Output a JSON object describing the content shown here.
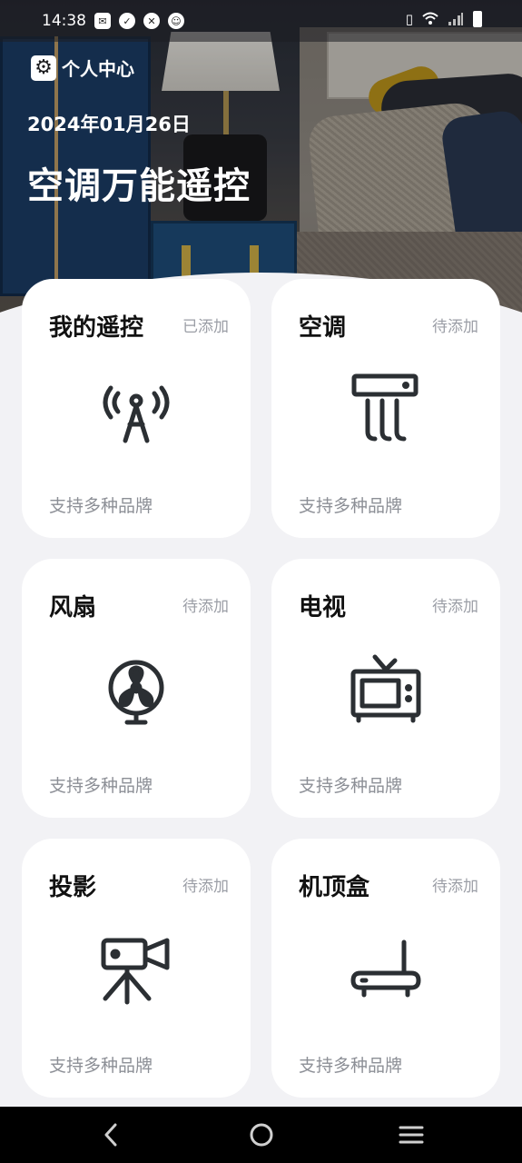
{
  "status_bar": {
    "time": "14:38",
    "left_icons": [
      "mail-icon",
      "check-circle-icon",
      "shield-icon",
      "alien-icon"
    ],
    "right_icons": [
      "vibrate-icon",
      "wifi-icon",
      "signal-icon",
      "battery-icon"
    ]
  },
  "header": {
    "personal_center": "个人中心",
    "date": "2024年01月26日",
    "app_title": "空调万能遥控"
  },
  "cards": [
    {
      "title": "我的遥控",
      "status": "已添加",
      "subtitle": "支持多种品牌",
      "icon": "antenna-tower-icon"
    },
    {
      "title": "空调",
      "status": "待添加",
      "subtitle": "支持多种品牌",
      "icon": "air-conditioner-icon"
    },
    {
      "title": "风扇",
      "status": "待添加",
      "subtitle": "支持多种品牌",
      "icon": "fan-icon"
    },
    {
      "title": "电视",
      "status": "待添加",
      "subtitle": "支持多种品牌",
      "icon": "tv-icon"
    },
    {
      "title": "投影",
      "status": "待添加",
      "subtitle": "支持多种品牌",
      "icon": "projector-camera-icon"
    },
    {
      "title": "机顶盒",
      "status": "待添加",
      "subtitle": "支持多种品牌",
      "icon": "set-top-box-icon"
    }
  ],
  "nav_bar": {
    "buttons": [
      "back-icon",
      "home-icon",
      "menu-icon"
    ]
  },
  "colors": {
    "page_bg": "#f2f2f5",
    "card_bg": "#ffffff",
    "title_text": "#111111",
    "muted_text": "#9b9ea6",
    "icon_stroke": "#2b2f33"
  }
}
